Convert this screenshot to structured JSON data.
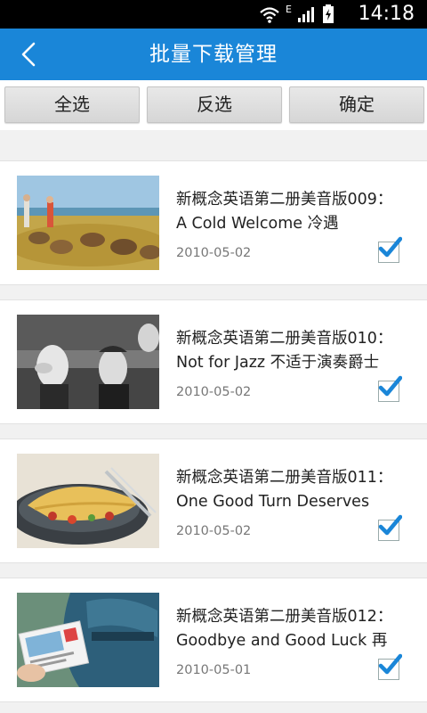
{
  "status_bar": {
    "time": "14:18",
    "network_badge": "E"
  },
  "header": {
    "title": "批量下载管理",
    "back_icon": "chevron-left-icon"
  },
  "toolbar": {
    "select_all": "全选",
    "invert": "反选",
    "confirm": "确定"
  },
  "items": [
    {
      "title": "新概念英语第二册美音版009：\nA Cold Welcome 冷遇",
      "date": "2010-05-02",
      "checked": true
    },
    {
      "title": "新概念英语第二册美音版010：\nNot for Jazz 不适于演奏爵士",
      "date": "2010-05-02",
      "checked": true
    },
    {
      "title": "新概念英语第二册美音版011：\nOne Good Turn Deserves",
      "date": "2010-05-02",
      "checked": true
    },
    {
      "title": "新概念英语第二册美音版012：\nGoodbye and Good Luck 再",
      "date": "2010-05-01",
      "checked": true
    }
  ],
  "colors": {
    "appbar": "#1a86d8",
    "check": "#1a86d8"
  }
}
